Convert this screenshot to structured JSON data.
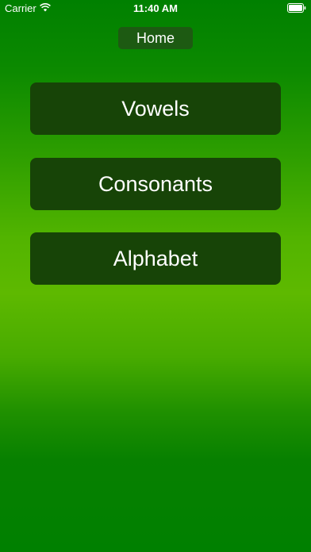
{
  "status_bar": {
    "carrier": "Carrier",
    "time": "11:40 AM",
    "icons": [
      "wifi-icon",
      "battery-icon"
    ]
  },
  "header": {
    "title": "Home"
  },
  "menu": {
    "items": [
      {
        "label": "Vowels"
      },
      {
        "label": "Consonants"
      },
      {
        "label": "Alphabet"
      }
    ]
  },
  "colors": {
    "background_top": "#008000",
    "background_mid": "#5eb900",
    "button_fill": "#174407",
    "home_pill_fill": "#1d5a12",
    "text": "#ffffff"
  }
}
